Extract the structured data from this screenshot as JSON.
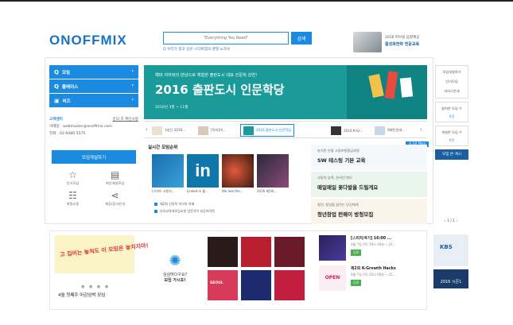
{
  "header": {
    "logo": "ONOFFMIX",
    "search_placeholder": "\"Everything You Need\"",
    "search_button": "검색",
    "search_hint": "Q 우리가 알고 싶은 스타트업의 경영 노하우",
    "promo_line1": "2016 퍼브릴 음향제공",
    "promo_line2": "활성화전략 전문교육"
  },
  "left_nav": {
    "items": [
      {
        "icon": "Q",
        "label": "모임"
      },
      {
        "icon": "Q",
        "label": "플레이스"
      },
      {
        "icon": "▣",
        "label": "비즈"
      }
    ]
  },
  "support": {
    "title": "고객센터",
    "faq": "문의 조 확인사항",
    "email": "이메일 : webmaster@onoffmix.com",
    "phone": "전화 : 02-6080-5575",
    "open_button": "모임개설하기"
  },
  "quick_links": [
    {
      "icon": "☆",
      "label": "인기모임"
    },
    {
      "icon": "▤",
      "label": "최신개설모임"
    },
    {
      "icon": "☷",
      "label": "회원쇼핑",
      "label_full": "회원소개"
    },
    {
      "icon": "⋖",
      "label": "제휴/광고안내"
    }
  ],
  "hero": {
    "subtitle": "해파 저자와의 만남으로 체험한 출판도시 대표 인문학 강연!",
    "title": "2016 출판도시 인문학당",
    "date": "2016년 3월 ~ 11월"
  },
  "strip": {
    "items": [
      {
        "label": "3성단 2016..."
      },
      {
        "label": "[독자]의..."
      },
      {
        "label": "2016 출판도시 인문학당"
      },
      {
        "label": "2016 K-Gr..."
      },
      {
        "label": "SW인증대..."
      }
    ]
  },
  "realtime": {
    "title": "실시간 모임순위",
    "cards": [
      {
        "caption": "[스마트 사용자..."
      },
      {
        "caption": "Linked-in 활..."
      },
      {
        "caption": "We See the..."
      },
      {
        "caption": "2016 제5회..."
      }
    ],
    "list": [
      "제2회 신앙적 지식의 지혜",
      "부모교육대모임교원 입문가이 성공하려면"
    ]
  },
  "ads": [
    {
      "sub": "놓치면 안될 고용보험환급과정",
      "bold": "SW 테스팅 기본 교육"
    },
    {
      "sub": "사람의 능력, 온라인 판다",
      "bold": "매일매일 꽃다발을 드릴게요"
    },
    {
      "sub": "청년, 창업을 꿈꾸는 당신에게",
      "bold": "청년창업 런웨이 방청모집"
    }
  ],
  "ad_badge": "4.18 Mon",
  "right_col": {
    "boxes": [
      {
        "label": "모임개설하기"
      },
      {
        "label": "인기모임"
      },
      {
        "label": "서비스안내"
      },
      {
        "label": "참여한 모임 수",
        "count": "0건"
      },
      {
        "label": "개설한 모임 수",
        "count": "0건"
      }
    ],
    "dark_button": "모임 본 게시",
    "pager": "1 / 1",
    "kbs": "KBS",
    "season": "2016 시즌1"
  },
  "bottom": {
    "banner_text": "고 집어는 놓쳐도 이 모임은 놓치지마!",
    "banner_caption": "4월 첫째주 마감임박 모임",
    "ask_q1": "심심하다구요?",
    "ask_q2": "모임 가시죠!",
    "grid_labels": [
      "",
      "",
      "",
      "SEOUL",
      "",
      ""
    ],
    "events": [
      {
        "title": "[스피치/4기] 16:00 ...",
        "meta": "4월 7일 (목) 19시 30분 ~ 21...",
        "tag": "무료"
      },
      {
        "title": "제2회 K-Growth Hacks",
        "meta": "4월 7일 (목) 20시 00분 ~ 21...",
        "tag": "무료"
      }
    ]
  }
}
